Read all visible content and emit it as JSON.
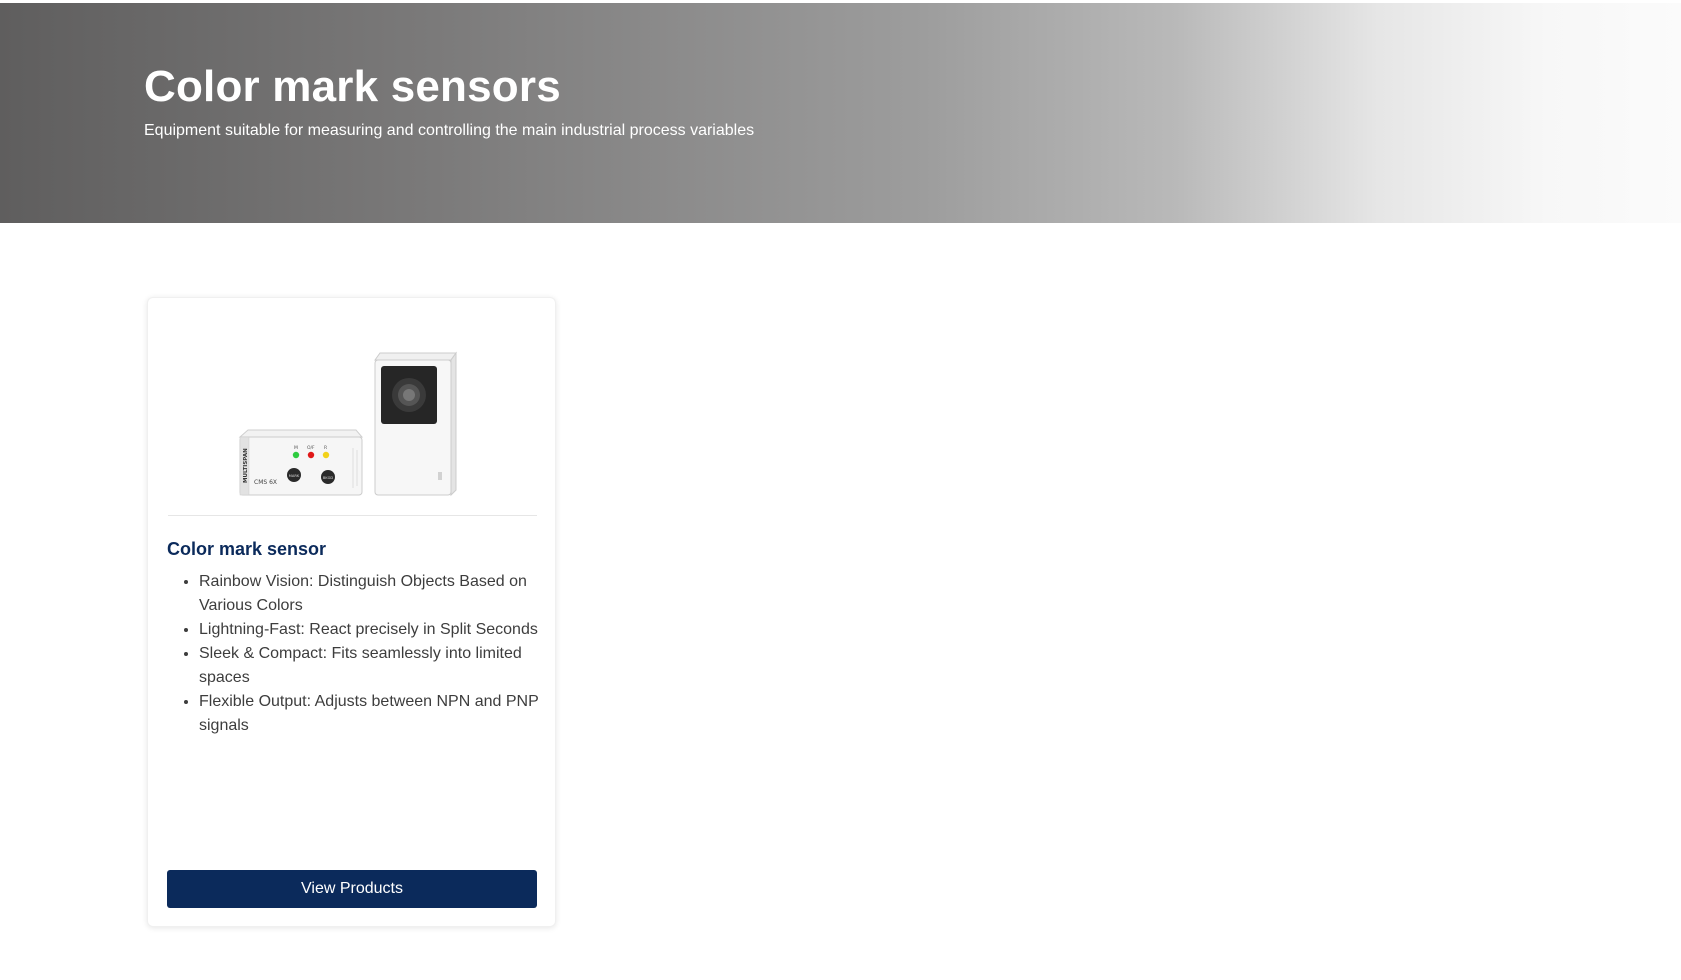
{
  "hero": {
    "title": "Color mark sensors",
    "subtitle": "Equipment suitable for measuring and controlling the main industrial process variables"
  },
  "products": [
    {
      "title": "Color mark sensor",
      "image_labels": {
        "brand": "MULTISPAN",
        "model": "CMS 6X",
        "led_labels": [
          "M",
          "O/F",
          "R"
        ],
        "button_labels": [
          "MARK",
          "BKGD"
        ]
      },
      "features": [
        "Rainbow Vision: Distinguish Objects Based on Various Colors",
        "Lightning-Fast: React precisely in Split Seconds",
        "Sleek & Compact: Fits seamlessly into limited spaces",
        "Flexible Output: Adjusts between NPN and PNP signals"
      ],
      "button_label": "View Products"
    }
  ],
  "colors": {
    "brand_navy": "#0b2a5b",
    "led_green": "#2ecc40",
    "led_red": "#e01818",
    "led_yellow": "#f2d21a"
  }
}
